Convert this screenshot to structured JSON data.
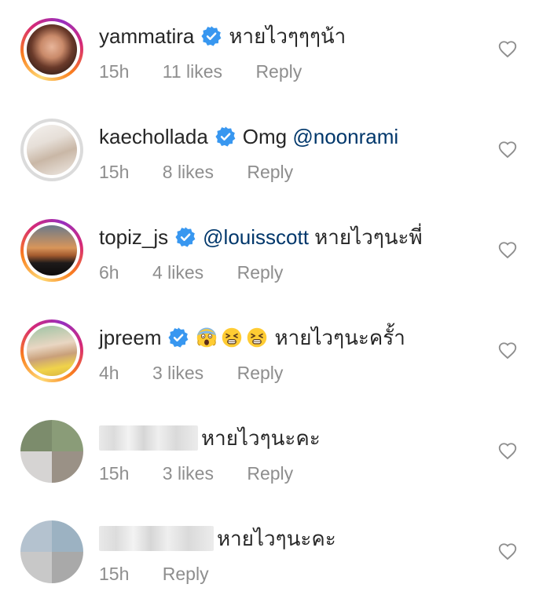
{
  "comments": [
    {
      "username": "yammatira",
      "verified": true,
      "mention": "",
      "text": "หายไวๆๆๆน้า",
      "time": "15h",
      "likes": "11 likes",
      "reply": "Reply"
    },
    {
      "username": "kaechollada",
      "verified": true,
      "text": "Omg",
      "mention": "@noonrami",
      "time": "15h",
      "likes": "8 likes",
      "reply": "Reply"
    },
    {
      "username": "topiz_js",
      "verified": true,
      "mention": "@louisscott",
      "text": "หายไวๆนะพี่",
      "time": "6h",
      "likes": "4 likes",
      "reply": "Reply"
    },
    {
      "username": "jpreem",
      "verified": true,
      "emojis": [
        "scream-emoji",
        "tired-face-emoji",
        "tired-face-emoji"
      ],
      "text": "หายไวๆนะครั้า",
      "time": "4h",
      "likes": "3 likes",
      "reply": "Reply"
    },
    {
      "username_blurred": true,
      "text": "หายไวๆนะคะ",
      "time": "15h",
      "likes": "3 likes",
      "reply": "Reply"
    },
    {
      "username_blurred": true,
      "text": "หายไวๆนะคะ",
      "time": "15h",
      "reply": "Reply"
    }
  ],
  "colors": {
    "text": "#262626",
    "meta": "#8e8e8e",
    "mention": "#00376b",
    "verified": "#3897f0"
  }
}
